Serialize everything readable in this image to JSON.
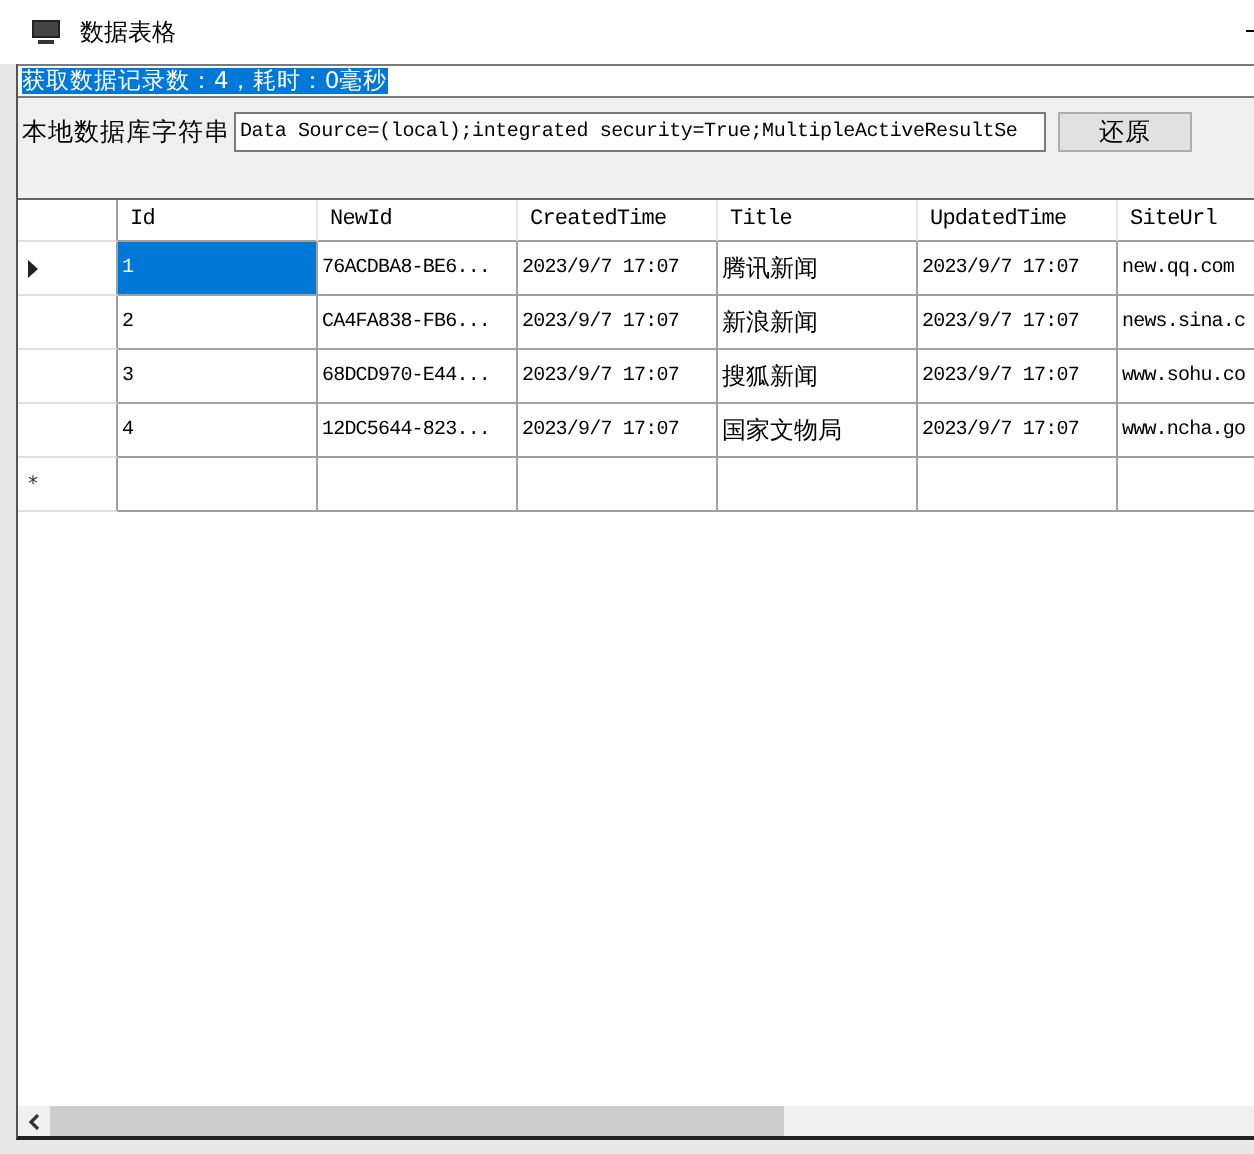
{
  "window": {
    "title": "数据表格"
  },
  "status_field": {
    "value": "获取数据记录数：4，耗时：0毫秒",
    "selected": true
  },
  "connection": {
    "label": "本地数据库字符串",
    "value": "Data Source=(local);integrated security=True;MultipleActiveResultSe"
  },
  "restore_button": {
    "label": "还原"
  },
  "grid": {
    "columns": [
      "Id",
      "NewId",
      "CreatedTime",
      "Title",
      "UpdatedTime",
      "SiteUrl"
    ],
    "rows": [
      {
        "current": true,
        "cells": [
          {
            "text": "1",
            "selected": true
          },
          {
            "text": "76ACDBA8-BE6...",
            "selected": false
          },
          {
            "text": "2023/9/7 17:07",
            "selected": false
          },
          {
            "text": "腾讯新闻",
            "selected": false
          },
          {
            "text": "2023/9/7 17:07",
            "selected": false
          },
          {
            "text": "new.qq.com",
            "selected": false
          }
        ]
      },
      {
        "current": false,
        "cells": [
          {
            "text": "2",
            "selected": false
          },
          {
            "text": "CA4FA838-FB6...",
            "selected": false
          },
          {
            "text": "2023/9/7 17:07",
            "selected": false
          },
          {
            "text": "新浪新闻",
            "selected": false
          },
          {
            "text": "2023/9/7 17:07",
            "selected": false
          },
          {
            "text": "news.sina.c",
            "selected": false
          }
        ]
      },
      {
        "current": false,
        "cells": [
          {
            "text": "3",
            "selected": false
          },
          {
            "text": "68DCD970-E44...",
            "selected": false
          },
          {
            "text": "2023/9/7 17:07",
            "selected": false
          },
          {
            "text": "搜狐新闻",
            "selected": false
          },
          {
            "text": "2023/9/7 17:07",
            "selected": false
          },
          {
            "text": "www.sohu.co",
            "selected": false
          }
        ]
      },
      {
        "current": false,
        "cells": [
          {
            "text": "4",
            "selected": false
          },
          {
            "text": "12DC5644-823...",
            "selected": false
          },
          {
            "text": "2023/9/7 17:07",
            "selected": false
          },
          {
            "text": "国家文物局",
            "selected": false
          },
          {
            "text": "2023/9/7 17:07",
            "selected": false
          },
          {
            "text": "www.ncha.go",
            "selected": false
          }
        ]
      }
    ],
    "new_row_marker": "*"
  }
}
